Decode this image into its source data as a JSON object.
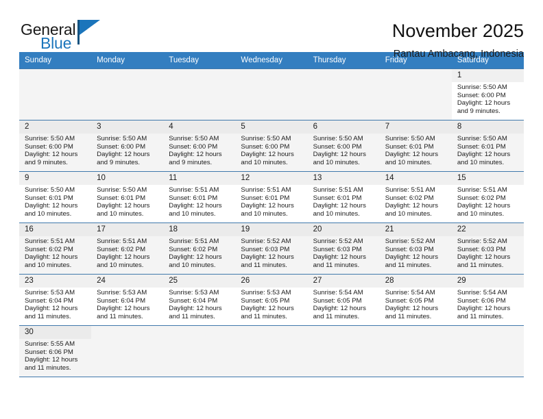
{
  "brand": {
    "name_top": "General",
    "name_bottom": "Blue",
    "accent_color": "#1b75bb"
  },
  "header": {
    "month_title": "November 2025",
    "location": "Rantau Ambacang, Indonesia"
  },
  "colors": {
    "header_row_bg": "#337ec0",
    "header_row_text": "#ffffff",
    "grid_line": "#3f78ab",
    "daynum_bg": "#f0f0f0",
    "shaded_cell_bg": "#f4f4f4"
  },
  "weekdays": [
    "Sunday",
    "Monday",
    "Tuesday",
    "Wednesday",
    "Thursday",
    "Friday",
    "Saturday"
  ],
  "labels": {
    "sunrise": "Sunrise:",
    "sunset": "Sunset:",
    "daylight": "Daylight:"
  },
  "weeks": [
    [
      {
        "day": "",
        "empty": true
      },
      {
        "day": "",
        "empty": true
      },
      {
        "day": "",
        "empty": true
      },
      {
        "day": "",
        "empty": true
      },
      {
        "day": "",
        "empty": true
      },
      {
        "day": "",
        "empty": true
      },
      {
        "day": "1",
        "sunrise": "Sunrise: 5:50 AM",
        "sunset": "Sunset: 6:00 PM",
        "daylight_1": "Daylight: 12 hours",
        "daylight_2": "and 9 minutes."
      }
    ],
    [
      {
        "day": "2",
        "sunrise": "Sunrise: 5:50 AM",
        "sunset": "Sunset: 6:00 PM",
        "daylight_1": "Daylight: 12 hours",
        "daylight_2": "and 9 minutes."
      },
      {
        "day": "3",
        "sunrise": "Sunrise: 5:50 AM",
        "sunset": "Sunset: 6:00 PM",
        "daylight_1": "Daylight: 12 hours",
        "daylight_2": "and 9 minutes."
      },
      {
        "day": "4",
        "sunrise": "Sunrise: 5:50 AM",
        "sunset": "Sunset: 6:00 PM",
        "daylight_1": "Daylight: 12 hours",
        "daylight_2": "and 9 minutes."
      },
      {
        "day": "5",
        "sunrise": "Sunrise: 5:50 AM",
        "sunset": "Sunset: 6:00 PM",
        "daylight_1": "Daylight: 12 hours",
        "daylight_2": "and 10 minutes."
      },
      {
        "day": "6",
        "sunrise": "Sunrise: 5:50 AM",
        "sunset": "Sunset: 6:00 PM",
        "daylight_1": "Daylight: 12 hours",
        "daylight_2": "and 10 minutes."
      },
      {
        "day": "7",
        "sunrise": "Sunrise: 5:50 AM",
        "sunset": "Sunset: 6:01 PM",
        "daylight_1": "Daylight: 12 hours",
        "daylight_2": "and 10 minutes."
      },
      {
        "day": "8",
        "sunrise": "Sunrise: 5:50 AM",
        "sunset": "Sunset: 6:01 PM",
        "daylight_1": "Daylight: 12 hours",
        "daylight_2": "and 10 minutes."
      }
    ],
    [
      {
        "day": "9",
        "sunrise": "Sunrise: 5:50 AM",
        "sunset": "Sunset: 6:01 PM",
        "daylight_1": "Daylight: 12 hours",
        "daylight_2": "and 10 minutes."
      },
      {
        "day": "10",
        "sunrise": "Sunrise: 5:50 AM",
        "sunset": "Sunset: 6:01 PM",
        "daylight_1": "Daylight: 12 hours",
        "daylight_2": "and 10 minutes."
      },
      {
        "day": "11",
        "sunrise": "Sunrise: 5:51 AM",
        "sunset": "Sunset: 6:01 PM",
        "daylight_1": "Daylight: 12 hours",
        "daylight_2": "and 10 minutes."
      },
      {
        "day": "12",
        "sunrise": "Sunrise: 5:51 AM",
        "sunset": "Sunset: 6:01 PM",
        "daylight_1": "Daylight: 12 hours",
        "daylight_2": "and 10 minutes."
      },
      {
        "day": "13",
        "sunrise": "Sunrise: 5:51 AM",
        "sunset": "Sunset: 6:01 PM",
        "daylight_1": "Daylight: 12 hours",
        "daylight_2": "and 10 minutes."
      },
      {
        "day": "14",
        "sunrise": "Sunrise: 5:51 AM",
        "sunset": "Sunset: 6:02 PM",
        "daylight_1": "Daylight: 12 hours",
        "daylight_2": "and 10 minutes."
      },
      {
        "day": "15",
        "sunrise": "Sunrise: 5:51 AM",
        "sunset": "Sunset: 6:02 PM",
        "daylight_1": "Daylight: 12 hours",
        "daylight_2": "and 10 minutes."
      }
    ],
    [
      {
        "day": "16",
        "sunrise": "Sunrise: 5:51 AM",
        "sunset": "Sunset: 6:02 PM",
        "daylight_1": "Daylight: 12 hours",
        "daylight_2": "and 10 minutes."
      },
      {
        "day": "17",
        "sunrise": "Sunrise: 5:51 AM",
        "sunset": "Sunset: 6:02 PM",
        "daylight_1": "Daylight: 12 hours",
        "daylight_2": "and 10 minutes."
      },
      {
        "day": "18",
        "sunrise": "Sunrise: 5:51 AM",
        "sunset": "Sunset: 6:02 PM",
        "daylight_1": "Daylight: 12 hours",
        "daylight_2": "and 10 minutes."
      },
      {
        "day": "19",
        "sunrise": "Sunrise: 5:52 AM",
        "sunset": "Sunset: 6:03 PM",
        "daylight_1": "Daylight: 12 hours",
        "daylight_2": "and 11 minutes."
      },
      {
        "day": "20",
        "sunrise": "Sunrise: 5:52 AM",
        "sunset": "Sunset: 6:03 PM",
        "daylight_1": "Daylight: 12 hours",
        "daylight_2": "and 11 minutes."
      },
      {
        "day": "21",
        "sunrise": "Sunrise: 5:52 AM",
        "sunset": "Sunset: 6:03 PM",
        "daylight_1": "Daylight: 12 hours",
        "daylight_2": "and 11 minutes."
      },
      {
        "day": "22",
        "sunrise": "Sunrise: 5:52 AM",
        "sunset": "Sunset: 6:03 PM",
        "daylight_1": "Daylight: 12 hours",
        "daylight_2": "and 11 minutes."
      }
    ],
    [
      {
        "day": "23",
        "sunrise": "Sunrise: 5:53 AM",
        "sunset": "Sunset: 6:04 PM",
        "daylight_1": "Daylight: 12 hours",
        "daylight_2": "and 11 minutes."
      },
      {
        "day": "24",
        "sunrise": "Sunrise: 5:53 AM",
        "sunset": "Sunset: 6:04 PM",
        "daylight_1": "Daylight: 12 hours",
        "daylight_2": "and 11 minutes."
      },
      {
        "day": "25",
        "sunrise": "Sunrise: 5:53 AM",
        "sunset": "Sunset: 6:04 PM",
        "daylight_1": "Daylight: 12 hours",
        "daylight_2": "and 11 minutes."
      },
      {
        "day": "26",
        "sunrise": "Sunrise: 5:53 AM",
        "sunset": "Sunset: 6:05 PM",
        "daylight_1": "Daylight: 12 hours",
        "daylight_2": "and 11 minutes."
      },
      {
        "day": "27",
        "sunrise": "Sunrise: 5:54 AM",
        "sunset": "Sunset: 6:05 PM",
        "daylight_1": "Daylight: 12 hours",
        "daylight_2": "and 11 minutes."
      },
      {
        "day": "28",
        "sunrise": "Sunrise: 5:54 AM",
        "sunset": "Sunset: 6:05 PM",
        "daylight_1": "Daylight: 12 hours",
        "daylight_2": "and 11 minutes."
      },
      {
        "day": "29",
        "sunrise": "Sunrise: 5:54 AM",
        "sunset": "Sunset: 6:06 PM",
        "daylight_1": "Daylight: 12 hours",
        "daylight_2": "and 11 minutes."
      }
    ],
    [
      {
        "day": "30",
        "sunrise": "Sunrise: 5:55 AM",
        "sunset": "Sunset: 6:06 PM",
        "daylight_1": "Daylight: 12 hours",
        "daylight_2": "and 11 minutes."
      },
      {
        "day": "",
        "blank": true
      },
      {
        "day": "",
        "blank": true
      },
      {
        "day": "",
        "blank": true
      },
      {
        "day": "",
        "blank": true
      },
      {
        "day": "",
        "blank": true
      },
      {
        "day": "",
        "blank": true
      }
    ]
  ]
}
